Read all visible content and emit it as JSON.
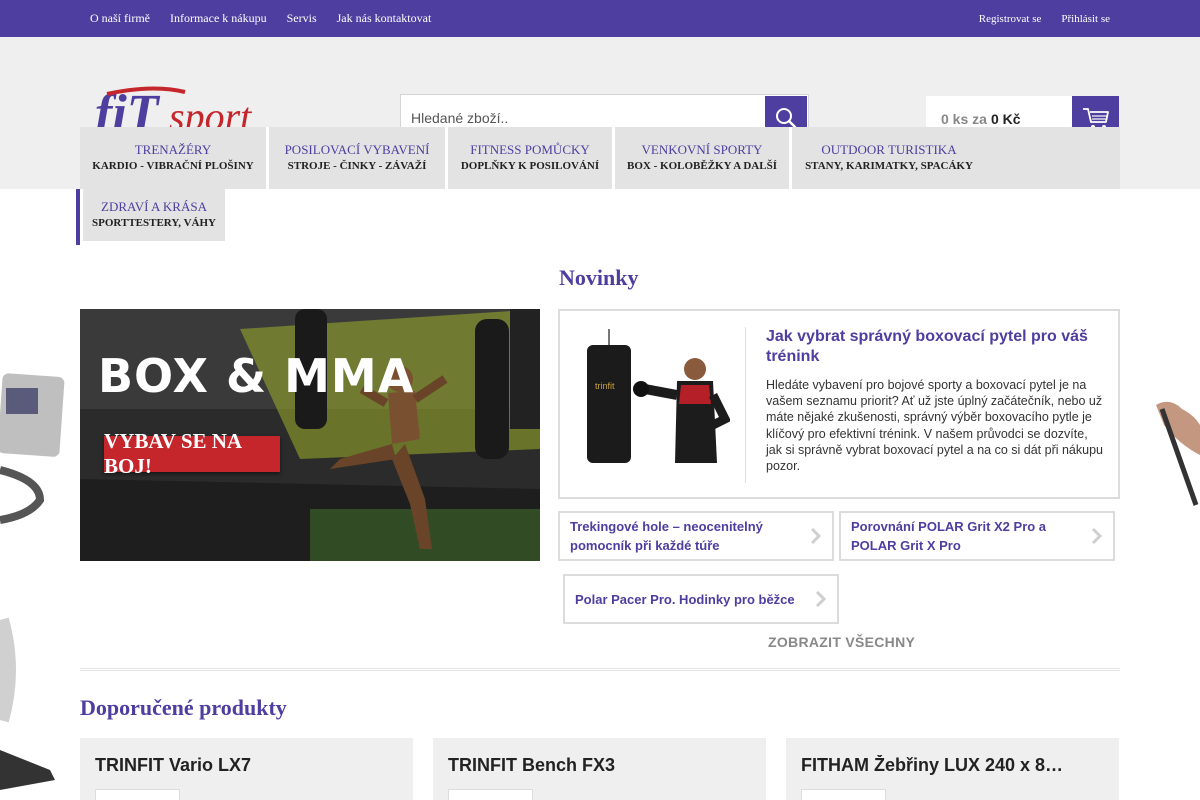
{
  "topbar": {
    "links": [
      "O naší firmě",
      "Informace k nákupu",
      "Servis",
      "Jak nás kontaktovat"
    ],
    "register": "Registrovat se",
    "login": "Přihlásit se"
  },
  "header": {
    "logo_text_fit": "fiT",
    "logo_text_sport": "sport",
    "search_placeholder": "Hledané zboží..",
    "cart_count": "0 ks za",
    "cart_amount": "0 Kč"
  },
  "nav": {
    "items": [
      {
        "title": "Trenažéry",
        "sub": "Kardio - vibrační plošiny"
      },
      {
        "title": "Posilovací vybavení",
        "sub": "Stroje - činky - závaží"
      },
      {
        "title": "Fitness pomůcky",
        "sub": "Doplňky k posilování"
      },
      {
        "title": "Venkovní sporty",
        "sub": "Box - koloběžky a další"
      },
      {
        "title": "Outdoor turistika",
        "sub": "Stany, karimatky, spacáky"
      },
      {
        "title": "Zdraví a krása",
        "sub": "Sporttestery, váhy"
      }
    ]
  },
  "banner": {
    "headline": "BOX & MMA",
    "cta": "VYBAV SE NA BOJ!"
  },
  "news": {
    "title": "Novinky",
    "feature": {
      "title": "Jak vybrat správný boxovací pytel pro váš trénink",
      "text": "Hledáte vybavení pro bojové sporty a boxovací pytel je na vašem seznamu priorit? Ať už jste úplný začátečník, nebo už máte nějaké zkušenosti, správný výběr boxovacího pytle je klíčový pro efektivní trénink. V našem průvodci se dozvíte, jak si správně vybrat boxovací pytel a na co si dát při nákupu pozor."
    },
    "cards": [
      "Trekingové hole – neocenitelný pomocník při každé túře",
      "Porovnání POLAR Grit X2 Pro a POLAR Grit X Pro",
      "Polar Pacer Pro. Hodinky pro běžce"
    ],
    "show_all": "ZOBRAZIT VŠECHNY"
  },
  "recommended": {
    "title": "Doporučené produkty",
    "products": [
      "TRINFIT Vario LX7",
      "TRINFIT Bench FX3",
      "FITHAM Žebřiny LUX 240 x 8…"
    ]
  },
  "colors": {
    "brand_purple": "#4d3ea0",
    "brand_red": "#c5262b",
    "header_bg": "#efefef"
  }
}
